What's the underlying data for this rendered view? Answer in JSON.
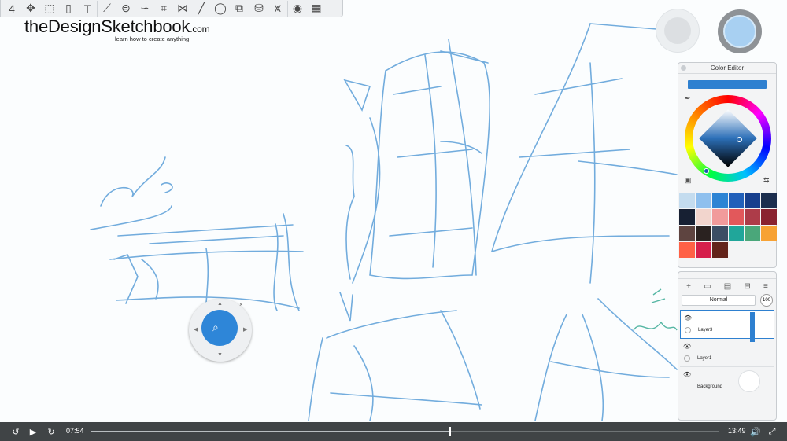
{
  "toolbar": {
    "tools": [
      {
        "name": "brush-size-icon",
        "glyph": "4"
      },
      {
        "name": "transform-icon",
        "glyph": "✥"
      },
      {
        "name": "crop-icon",
        "glyph": "⬚"
      },
      {
        "name": "cylinder-icon",
        "glyph": "▯"
      },
      {
        "name": "text-icon",
        "glyph": "T"
      },
      {
        "name": "ruler-icon",
        "glyph": "⟋"
      },
      {
        "name": "ellipse-guide-icon",
        "glyph": "⊜"
      },
      {
        "name": "french-curve-icon",
        "glyph": "∽"
      },
      {
        "name": "perspective-icon",
        "glyph": "⌗"
      },
      {
        "name": "symmetry-icon",
        "glyph": "⋈"
      },
      {
        "name": "line-icon",
        "glyph": "╱"
      },
      {
        "name": "circle-icon",
        "glyph": "◯"
      },
      {
        "name": "shape-icon",
        "glyph": "⧉"
      },
      {
        "name": "fill-icon",
        "glyph": "⛁"
      },
      {
        "name": "brush-library-icon",
        "glyph": "⩙"
      },
      {
        "name": "color-wheel-icon",
        "glyph": "◉"
      },
      {
        "name": "layer-grid-icon",
        "glyph": "▦"
      }
    ]
  },
  "logo": {
    "title": "theDesignSketchbook",
    "suffix": ".com",
    "tagline": "learn how to create anything"
  },
  "color_editor": {
    "title": "Color Editor",
    "current_color": "#2e80d0",
    "swatches": [
      "#c4dcef",
      "#8fc0ee",
      "#2d84d4",
      "#2160ba",
      "#173f8d",
      "#1c2e4e",
      "#172033",
      "#f2d5cd",
      "#f19b9b",
      "#e2585b",
      "#ad3c49",
      "#8a2330",
      "#5e4440",
      "#2a2220",
      "#3c4e64",
      "#20a69a",
      "#4aa77a",
      "#f7a234",
      "#ff6146",
      "#d61f4c",
      "#63241b"
    ]
  },
  "layers": {
    "blend_mode": "Normal",
    "opacity": "100",
    "items": [
      {
        "label": "Layer3"
      },
      {
        "label": "Layer1"
      },
      {
        "label": "Background"
      }
    ]
  },
  "player": {
    "current_time": "07:54",
    "duration": "13:49",
    "progress": 0.572
  }
}
